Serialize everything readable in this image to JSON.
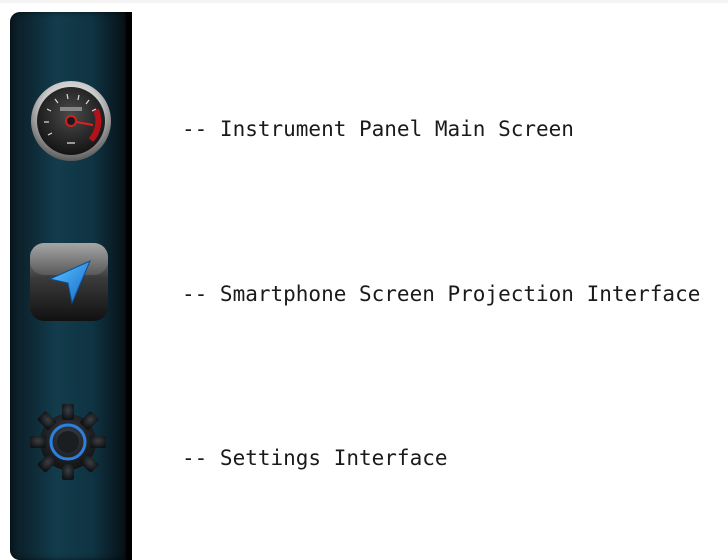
{
  "sidebar": {
    "items": [
      {
        "icon": "speedometer-icon",
        "label": "-- Instrument Panel Main Screen"
      },
      {
        "icon": "navigation-arrow-icon",
        "label": "-- Smartphone Screen Projection Interface"
      },
      {
        "icon": "gear-icon",
        "label": "-- Settings Interface"
      }
    ]
  },
  "colors": {
    "sidebar_dark": "#0a1a22",
    "sidebar_teal": "#123c4c",
    "gauge_red": "#b3121b",
    "nav_blue": "#1e90e8",
    "gear_ring_blue": "#2d7fe0"
  }
}
